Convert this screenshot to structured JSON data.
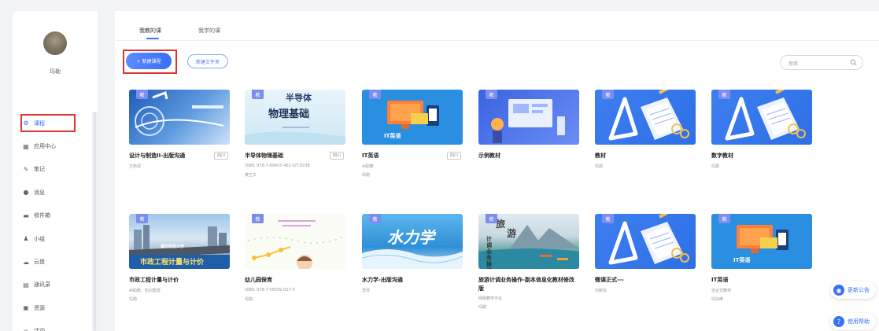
{
  "user": {
    "name": "玛勒"
  },
  "sidebar": {
    "items": [
      {
        "label": "课程",
        "icon": "gear-icon",
        "glyph": "⚙",
        "active": true
      },
      {
        "label": "应用中心",
        "icon": "apps-icon",
        "glyph": "▦"
      },
      {
        "label": "笔记",
        "icon": "pen-icon",
        "glyph": "✎"
      },
      {
        "label": "消息",
        "icon": "bell-icon",
        "glyph": "●"
      },
      {
        "label": "收件箱",
        "icon": "inbox-icon",
        "glyph": "▬"
      },
      {
        "label": "小组",
        "icon": "group-icon",
        "glyph": "♟"
      },
      {
        "label": "云盘",
        "icon": "cloud-icon",
        "glyph": "☁"
      },
      {
        "label": "通讯录",
        "icon": "contacts-icon",
        "glyph": "▤"
      },
      {
        "label": "资源",
        "icon": "resource-icon",
        "glyph": "▣"
      },
      {
        "label": "活动",
        "icon": "activity-icon",
        "glyph": "≡"
      }
    ]
  },
  "tabs": [
    {
      "label": "我教的课",
      "active": true
    },
    {
      "label": "我学的课"
    }
  ],
  "toolbar": {
    "new_course": "+ 新建课程",
    "new_folder": "新建文件夹",
    "search_placeholder": "搜索"
  },
  "tag_label": "教",
  "courses": [
    {
      "title": "设计与制造II-出版沟通",
      "badge": "四川",
      "meta": [
        "王新成"
      ],
      "art": "design"
    },
    {
      "title": "半导体物理基础",
      "badge": "四川",
      "meta": [
        "ISBN: 978-7-89407-462-5/T.D038",
        "黄王文"
      ],
      "art": "physics",
      "art_text": [
        "半导体",
        "物理基础"
      ]
    },
    {
      "title": "IT英语",
      "badge": "四川",
      "meta": [
        "AI助教",
        "玛勒"
      ],
      "art": "it",
      "art_text": [
        "IT英语"
      ]
    },
    {
      "title": "示例教材",
      "meta": [],
      "art": "sample"
    },
    {
      "title": "教材",
      "meta": [
        "玛勒"
      ],
      "art": "book"
    },
    {
      "title": "数字教材",
      "meta": [
        "玛勒"
      ],
      "art": "book"
    },
    {
      "title": "市政工程计量与计价",
      "meta": [
        "AI助教、知识图谱",
        "玛勒"
      ],
      "art": "civil",
      "art_text": [
        "重庆科技大学",
        "市政工程计量与计价"
      ]
    },
    {
      "title": "幼儿园保育",
      "meta": [
        "ISBN: 978-7-56599-027-5",
        "玛勒"
      ],
      "art": "kids"
    },
    {
      "title": "水力学-出版沟通",
      "meta": [
        "李祥"
      ],
      "art": "water",
      "art_text": [
        "水力学"
      ]
    },
    {
      "title": "旅游计调业务操作-副本信息化教材修改版",
      "meta": [
        "网络教学平台",
        "玛勒"
      ],
      "art": "travel",
      "art_text": [
        "旅",
        "游",
        "计调业务操作"
      ]
    },
    {
      "title": "微课正式---",
      "meta": [
        "刘新坛"
      ],
      "art": "book"
    },
    {
      "title": "IT英语",
      "meta": [
        "混合式教材",
        "玛刘维"
      ],
      "art": "it",
      "art_text": [
        "IT英语"
      ]
    }
  ],
  "floats": [
    {
      "label": "更新公告",
      "icon": "announcement-icon",
      "glyph": "◉"
    },
    {
      "label": "使用帮助",
      "icon": "help-icon",
      "glyph": "?"
    }
  ],
  "colors": {
    "accent": "#3a6ff7",
    "highlight": "#e0322f",
    "tag": "#7b8df0"
  }
}
